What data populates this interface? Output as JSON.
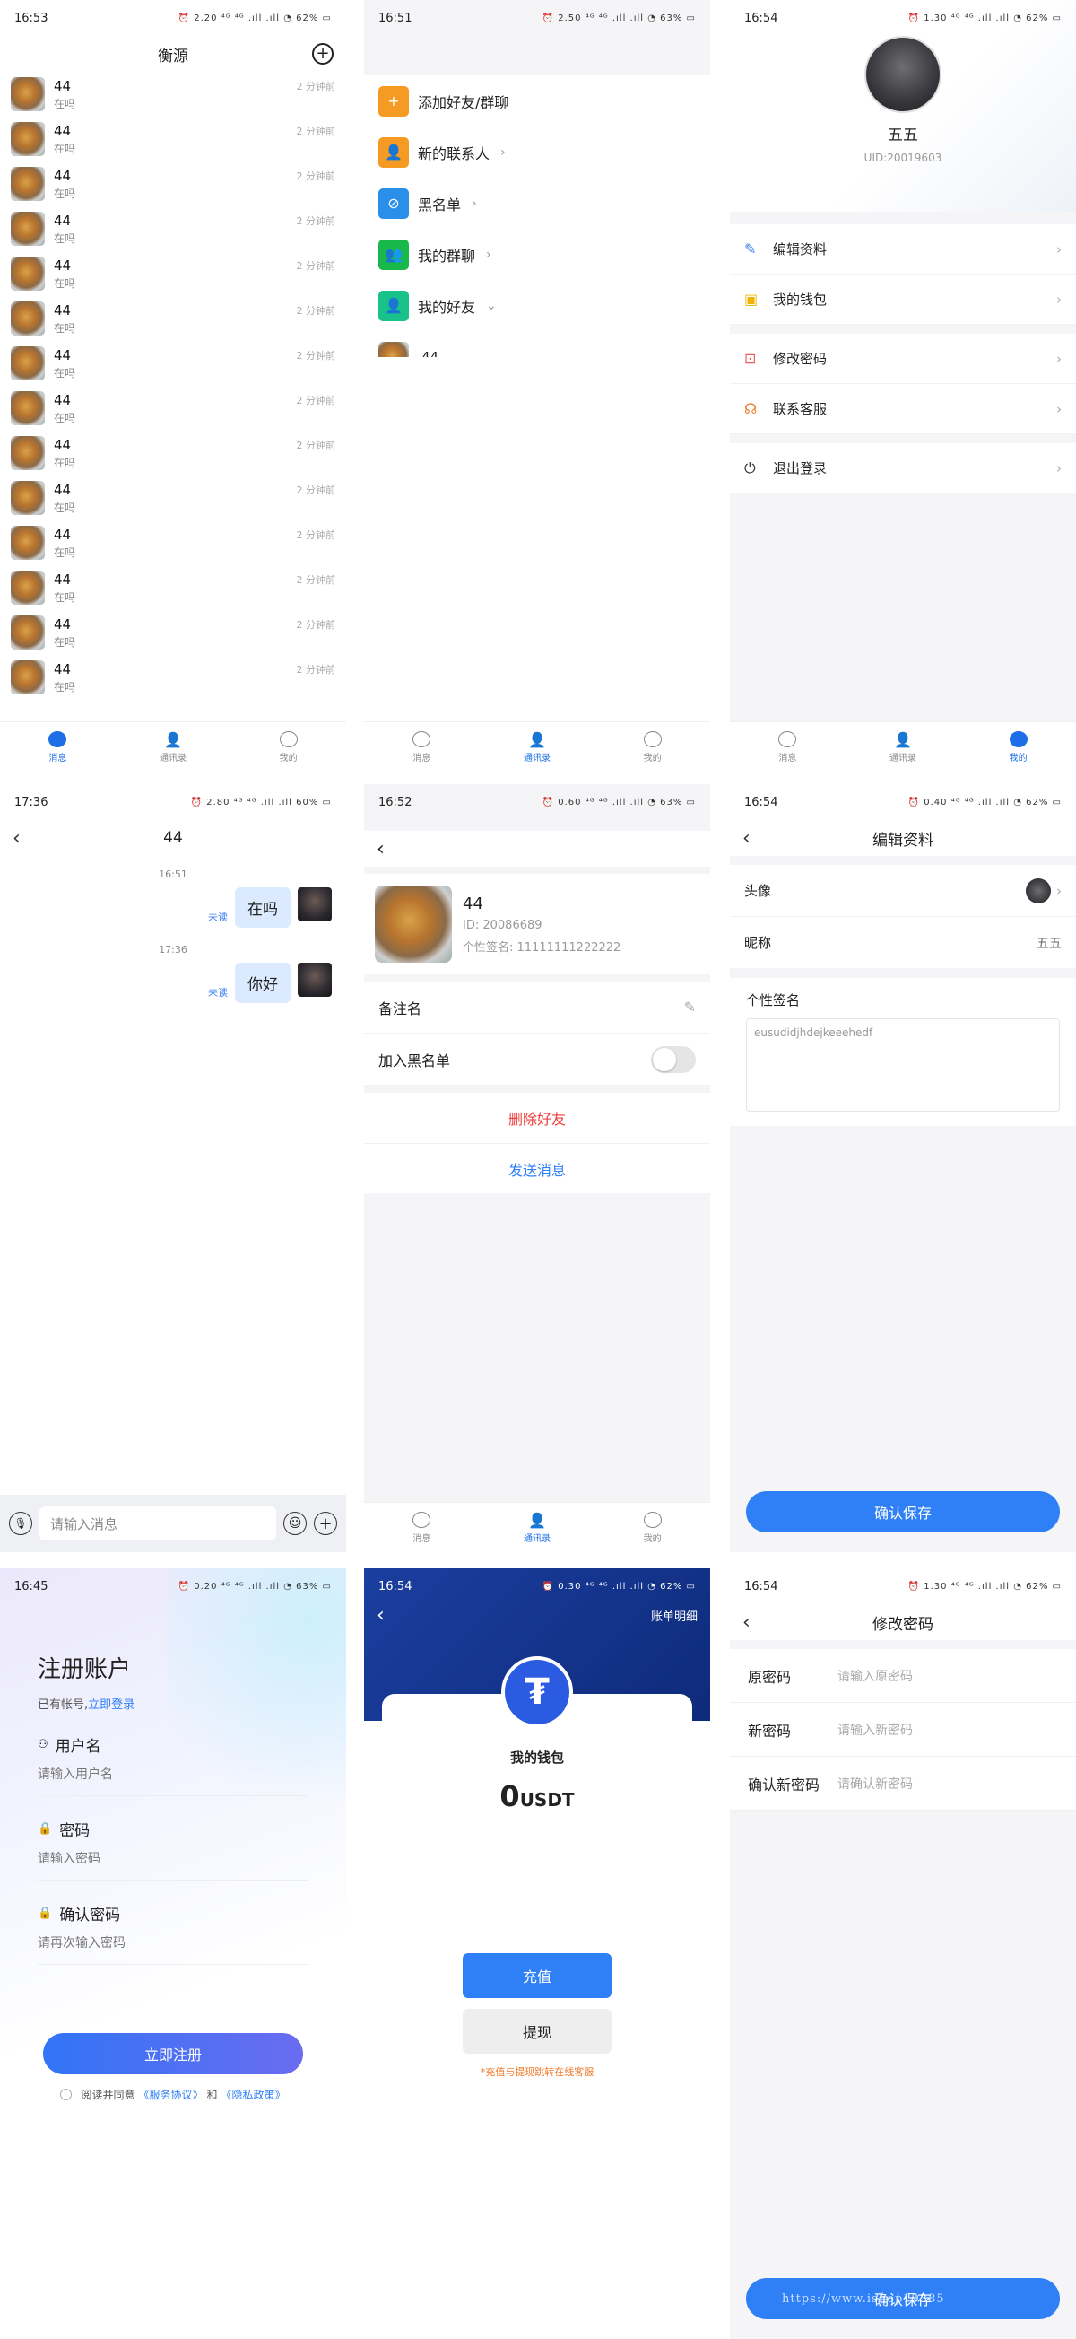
{
  "s1": {
    "time": "16:53",
    "status_right": "⏰ 2.20 ⁴ᴳ ⁴ᴳ .ıll .ıll ◔ 62% ▭",
    "title": "衡源",
    "rows": [
      {
        "name": "44",
        "status": "在吗",
        "time": "2 分钟前"
      },
      {
        "name": "44",
        "status": "在吗",
        "time": "2 分钟前"
      },
      {
        "name": "44",
        "status": "在吗",
        "time": "2 分钟前"
      },
      {
        "name": "44",
        "status": "在吗",
        "time": "2 分钟前"
      },
      {
        "name": "44",
        "status": "在吗",
        "time": "2 分钟前"
      },
      {
        "name": "44",
        "status": "在吗",
        "time": "2 分钟前"
      },
      {
        "name": "44",
        "status": "在吗",
        "time": "2 分钟前"
      },
      {
        "name": "44",
        "status": "在吗",
        "time": "2 分钟前"
      },
      {
        "name": "44",
        "status": "在吗",
        "time": "2 分钟前"
      },
      {
        "name": "44",
        "status": "在吗",
        "time": "2 分钟前"
      },
      {
        "name": "44",
        "status": "在吗",
        "time": "2 分钟前"
      },
      {
        "name": "44",
        "status": "在吗",
        "time": "2 分钟前"
      },
      {
        "name": "44",
        "status": "在吗",
        "time": "2 分钟前"
      },
      {
        "name": "44",
        "status": "在吗",
        "time": "2 分钟前"
      }
    ]
  },
  "tabs": {
    "messages": "消息",
    "contacts": "通讯录",
    "mine": "我的"
  },
  "s2": {
    "time": "16:51",
    "status_right": "⏰ 2.50 ⁴ᴳ ⁴ᴳ .ıll .ıll ◔ 63% ▭",
    "items": [
      {
        "label": "添加好友/群聊",
        "color": "#f59a23"
      },
      {
        "label": "新的联系人",
        "color": "#f59a23"
      },
      {
        "label": "黑名单",
        "color": "#2a8fe8"
      },
      {
        "label": "我的群聊",
        "color": "#19b84a"
      },
      {
        "label": "我的好友",
        "color": "#19c28a"
      }
    ],
    "friend": "44"
  },
  "s3": {
    "time": "16:54",
    "status_right": "⏰ 1.30 ⁴ᴳ ⁴ᴳ .ıll .ıll ◔ 62% ▭",
    "name": "五五",
    "uid": "UID:20019603",
    "menu1": [
      "编辑资料",
      "我的钱包"
    ],
    "menu2": [
      "修改密码",
      "联系客服"
    ],
    "menu3": [
      "退出登录"
    ]
  },
  "s4": {
    "time": "17:36",
    "status_right": "⏰ 2.80 ⁴ᴳ ⁴ᴳ .ıll .ıll 60% ▭",
    "title": "44",
    "msgs": [
      {
        "time": "16:51",
        "text": "在吗",
        "flag": "未读"
      },
      {
        "time": "17:36",
        "text": "你好",
        "flag": "未读"
      }
    ],
    "input_placeholder": "请输入消息"
  },
  "s5": {
    "time": "16:52",
    "status_right": "⏰ 0.60 ⁴ᴳ ⁴ᴳ .ıll .ıll ◔ 63% ▭",
    "name": "44",
    "id": "ID: 20086689",
    "sign": "个性签名: 11111111222222",
    "remark": "备注名",
    "blacklist": "加入黑名单",
    "delete": "删除好友",
    "send": "发送消息"
  },
  "s6": {
    "time": "16:54",
    "status_right": "⏰ 0.40 ⁴ᴳ ⁴ᴳ .ıll .ıll ◔ 62% ▭",
    "title": "编辑资料",
    "avatar_label": "头像",
    "nick_label": "昵称",
    "nick_value": "五五",
    "sign_label": "个性签名",
    "sign_value": "eusudidjhdejkeeehedf",
    "save": "确认保存"
  },
  "s7": {
    "time": "16:45",
    "status_right": "⏰ 0.20 ⁴ᴳ ⁴ᴳ .ıll .ıll ◔ 63% ▭",
    "title": "注册账户",
    "has_account": "已有帐号,",
    "login_link": "立即登录",
    "fields": [
      {
        "label": "用户名",
        "placeholder": "请输入用户名"
      },
      {
        "label": "密码",
        "placeholder": "请输入密码"
      },
      {
        "label": "确认密码",
        "placeholder": "请再次输入密码"
      }
    ],
    "register": "立即注册",
    "agree_prefix": "阅读并同意",
    "service": "《服务协议》",
    "and": "和",
    "privacy": "《隐私政策》"
  },
  "s8": {
    "time": "16:54",
    "status_right": "⏰ 0.30 ⁴ᴳ ⁴ᴳ .ıll .ıll ◔ 62% ▭",
    "bill": "账单明细",
    "title": "我的钱包",
    "amount": "0",
    "unit": "USDT",
    "recharge": "充值",
    "withdraw": "提现",
    "note": "*充值与提现跳转在线客服"
  },
  "s9": {
    "time": "16:54",
    "status_right": "⏰ 1.30 ⁴ᴳ ⁴ᴳ .ıll .ıll ◔ 62% ▭",
    "title": "修改密码",
    "rows": [
      {
        "label": "原密码",
        "placeholder": "请输入原密码"
      },
      {
        "label": "新密码",
        "placeholder": "请输入新密码"
      },
      {
        "label": "确认新密码",
        "placeholder": "请确认新密码"
      }
    ],
    "save": "确认保存",
    "watermark": "https://www.ishop19385"
  }
}
